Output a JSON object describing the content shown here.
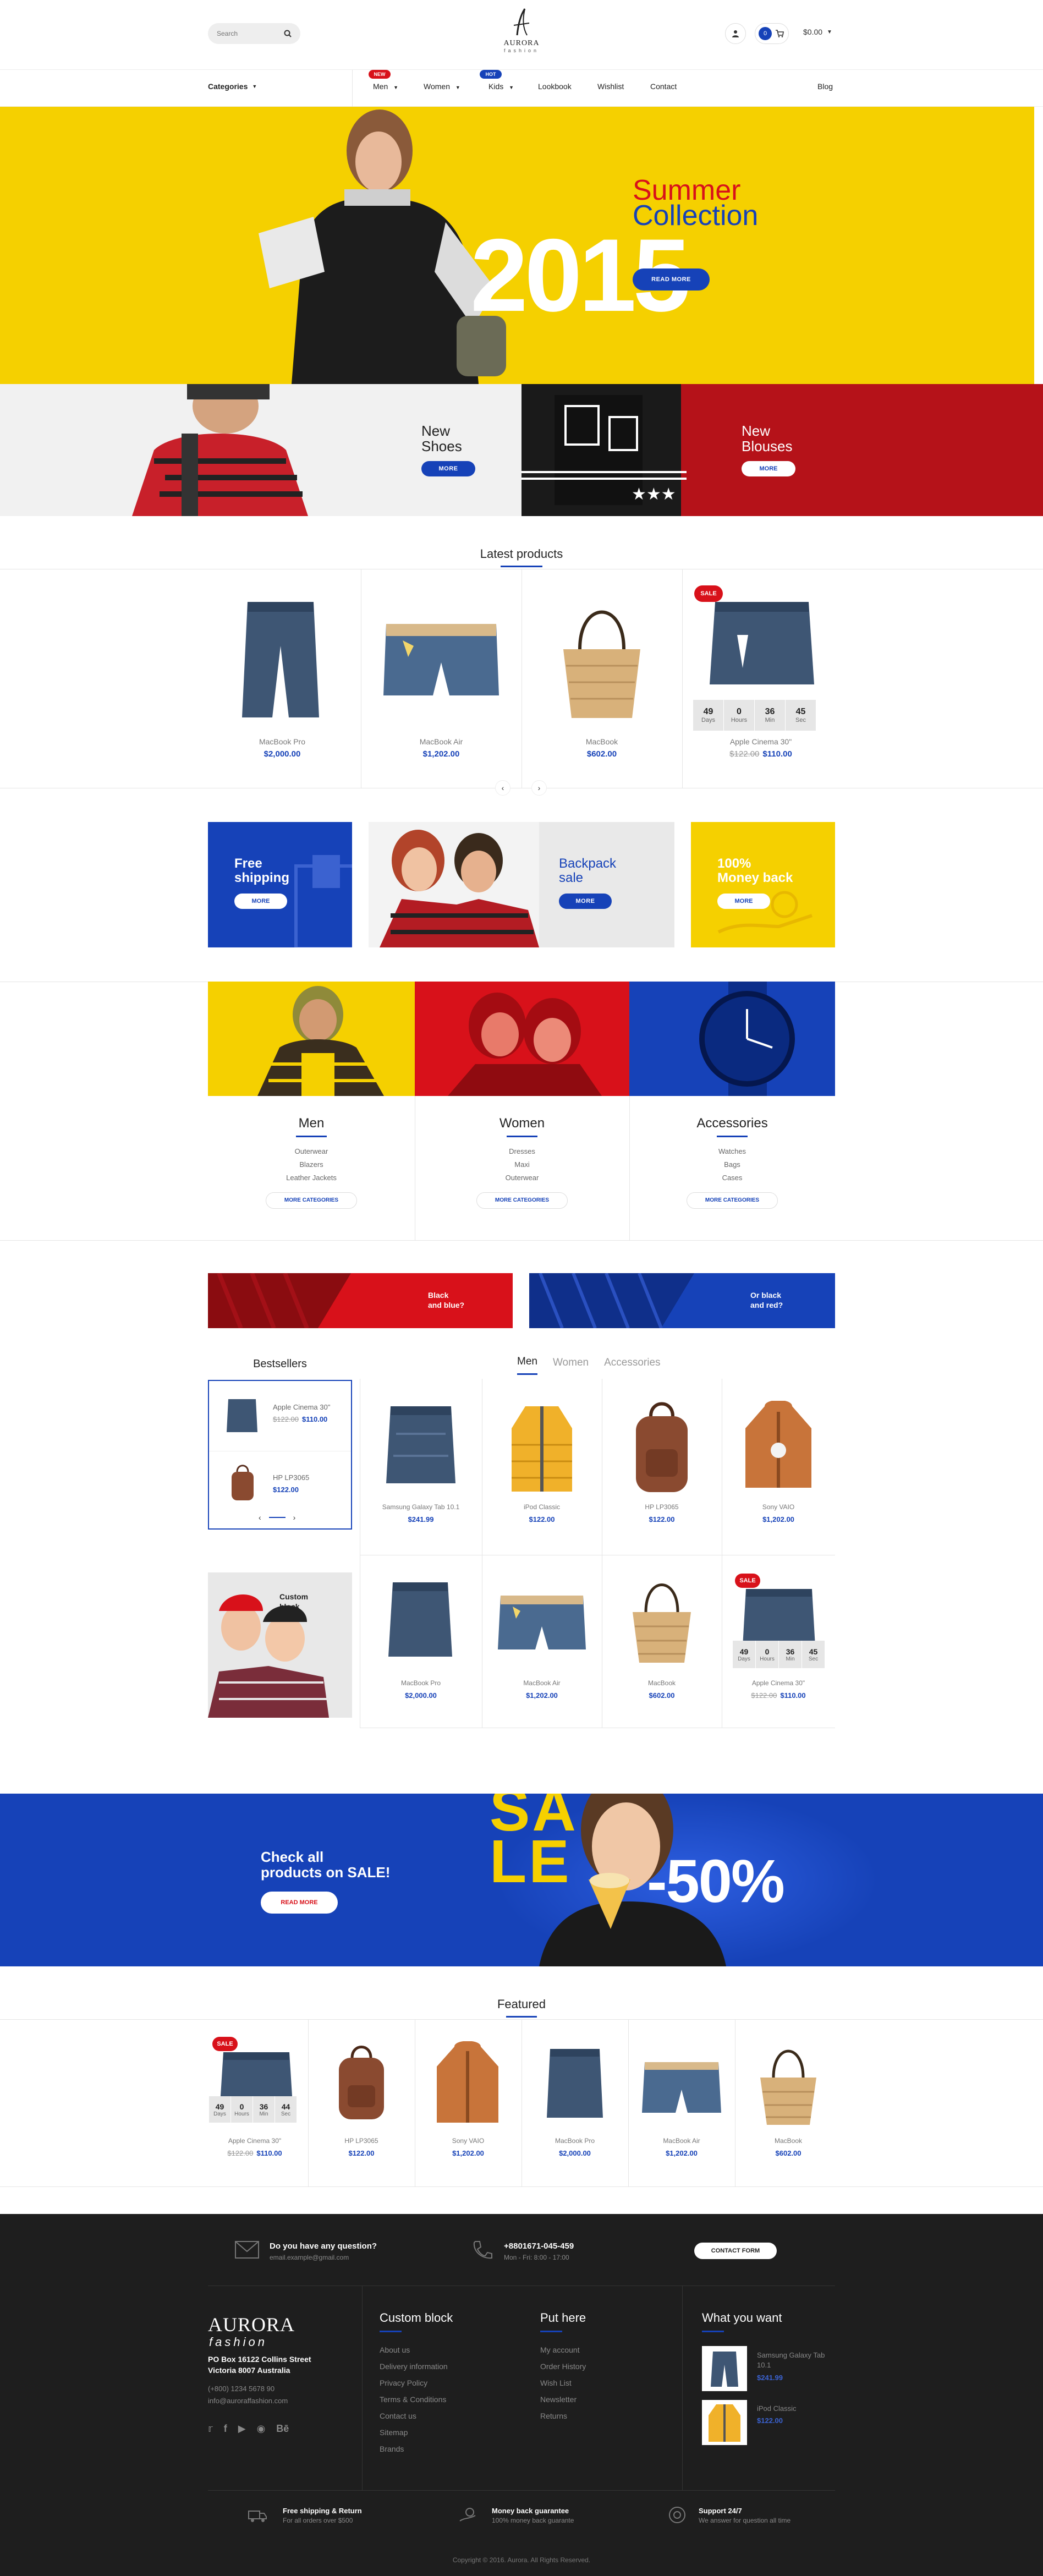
{
  "colors": {
    "brand": "#1642b8",
    "yellow": "#f5d000",
    "red": "#d8111a",
    "dark": "#1e1e1e"
  },
  "header": {
    "search_placeholder": "Search",
    "logo_name": "AURORA",
    "logo_sub": "fashion",
    "cart_count": "0",
    "cart_total": "$0.00"
  },
  "nav": {
    "categories": "Categories",
    "items": [
      {
        "label": "Men",
        "badge": "NEW"
      },
      {
        "label": "Women",
        "badge": ""
      },
      {
        "label": "Kids",
        "badge": "HOT"
      },
      {
        "label": "Lookbook",
        "badge": ""
      },
      {
        "label": "Wishlist",
        "badge": ""
      },
      {
        "label": "Contact",
        "badge": ""
      }
    ],
    "blog": "Blog"
  },
  "hero": {
    "line1": "Summer",
    "line2": "Collection",
    "year": "2015",
    "button": "READ MORE"
  },
  "promo": {
    "shoes": {
      "title1": "New",
      "title2": "Shoes",
      "button": "MORE"
    },
    "blouses": {
      "title1": "New",
      "title2": "Blouses",
      "button": "MORE"
    }
  },
  "latest": {
    "title": "Latest products",
    "products": [
      {
        "name": "MacBook Pro",
        "price": "$2,000.00",
        "old": ""
      },
      {
        "name": "MacBook Air",
        "price": "$1,202.00",
        "old": ""
      },
      {
        "name": "MacBook",
        "price": "$602.00",
        "old": ""
      },
      {
        "name": "Apple Cinema 30\"",
        "price": "$110.00",
        "old": "$122.00",
        "sale": "SALE",
        "countdown": [
          {
            "v": "49",
            "l": "Days"
          },
          {
            "v": "0",
            "l": "Hours"
          },
          {
            "v": "36",
            "l": "Min"
          },
          {
            "v": "45",
            "l": "Sec"
          }
        ]
      }
    ]
  },
  "banners3": {
    "shipping": {
      "l1": "Free",
      "l2": "shipping",
      "button": "MORE"
    },
    "backpack": {
      "l1": "Backpack",
      "l2": "sale",
      "button": "MORE"
    },
    "money": {
      "l1": "100%",
      "l2": "Money back",
      "button": "MORE"
    }
  },
  "categories": [
    {
      "title": "Men",
      "links": [
        "Outerwear",
        "Blazers",
        "Leather Jackets"
      ],
      "button": "MORE CATEGORIES"
    },
    {
      "title": "Women",
      "links": [
        "Dresses",
        "Maxi",
        "Outerwear"
      ],
      "button": "MORE CATEGORIES"
    },
    {
      "title": "Accessories",
      "links": [
        "Watches",
        "Bags",
        "Cases"
      ],
      "button": "MORE CATEGORIES"
    }
  ],
  "duo": {
    "left": {
      "l1": "Black",
      "l2": "and blue?"
    },
    "right": {
      "l1": "Or black",
      "l2": "and red?"
    }
  },
  "bestsellers": {
    "title": "Bestsellers",
    "items": [
      {
        "name": "Apple Cinema 30\"",
        "old": "$122.00",
        "price": "$110.00"
      },
      {
        "name": "HP LP3065",
        "old": "",
        "price": "$122.00"
      }
    ],
    "custom": {
      "l1": "Custom",
      "l2": "block"
    }
  },
  "tabs": [
    "Men",
    "Women",
    "Accessories"
  ],
  "grid": {
    "row1": [
      {
        "name": "Samsung Galaxy Tab 10.1",
        "price": "$241.99"
      },
      {
        "name": "iPod Classic",
        "price": "$122.00"
      },
      {
        "name": "HP LP3065",
        "price": "$122.00"
      },
      {
        "name": "Sony VAIO",
        "price": "$1,202.00"
      }
    ],
    "row2": [
      {
        "name": "MacBook Pro",
        "price": "$2,000.00"
      },
      {
        "name": "MacBook Air",
        "price": "$1,202.00"
      },
      {
        "name": "MacBook",
        "price": "$602.00"
      },
      {
        "name": "Apple Cinema 30\"",
        "price": "$110.00",
        "old": "$122.00",
        "sale": "SALE",
        "countdown": [
          {
            "v": "49",
            "l": "Days"
          },
          {
            "v": "0",
            "l": "Hours"
          },
          {
            "v": "36",
            "l": "Min"
          },
          {
            "v": "45",
            "l": "Sec"
          }
        ]
      }
    ]
  },
  "salebanner": {
    "l1": "Check all",
    "l2": "products on SALE!",
    "button": "READ MORE",
    "sale1": "SA",
    "sale2": "LE",
    "percent": "-50%"
  },
  "featured": {
    "title": "Featured",
    "products": [
      {
        "name": "Apple Cinema 30\"",
        "price": "$110.00",
        "old": "$122.00",
        "sale": "SALE",
        "countdown": [
          {
            "v": "49",
            "l": "Days"
          },
          {
            "v": "0",
            "l": "Hours"
          },
          {
            "v": "36",
            "l": "Min"
          },
          {
            "v": "44",
            "l": "Sec"
          }
        ]
      },
      {
        "name": "HP LP3065",
        "price": "$122.00"
      },
      {
        "name": "Sony VAIO",
        "price": "$1,202.00"
      },
      {
        "name": "MacBook Pro",
        "price": "$2,000.00"
      },
      {
        "name": "MacBook Air",
        "price": "$1,202.00"
      },
      {
        "name": "MacBook",
        "price": "$602.00"
      }
    ]
  },
  "footer": {
    "question": "Do you have any question?",
    "email": "email.example@gmail.com",
    "phone": "+8801671-045-459",
    "hours": "Mon - Fri: 8:00 - 17:00",
    "contact_btn": "CONTACT FORM",
    "logo1": "AURORA",
    "logo2": "fashion",
    "address1": "PO Box 16122 Collins Street",
    "address2": "Victoria 8007 Australia",
    "tel": "(+800) 1234 5678 90",
    "mail": "info@auroraffashion.com",
    "col1": {
      "title": "Custom block",
      "links": [
        "About us",
        "Delivery information",
        "Privacy Policy",
        "Terms & Conditions",
        "Contact us",
        "Sitemap",
        "Brands"
      ]
    },
    "col2": {
      "title": "Put here",
      "links": [
        "My account",
        "Order History",
        "Wish List",
        "Newsletter",
        "Returns"
      ]
    },
    "col3": {
      "title": "What you want",
      "items": [
        {
          "name": "Samsung Galaxy Tab 10.1",
          "price": "$241.99"
        },
        {
          "name": "iPod Classic",
          "price": "$122.00"
        }
      ]
    },
    "features": [
      {
        "t": "Free shipping & Return",
        "s": "For all orders over $500"
      },
      {
        "t": "Money back guarantee",
        "s": "100% money back guarante"
      },
      {
        "t": "Support 24/7",
        "s": "We answer for question all time"
      }
    ],
    "copyright": "Copyright © 2016. Aurora. All Rights Reserved."
  }
}
